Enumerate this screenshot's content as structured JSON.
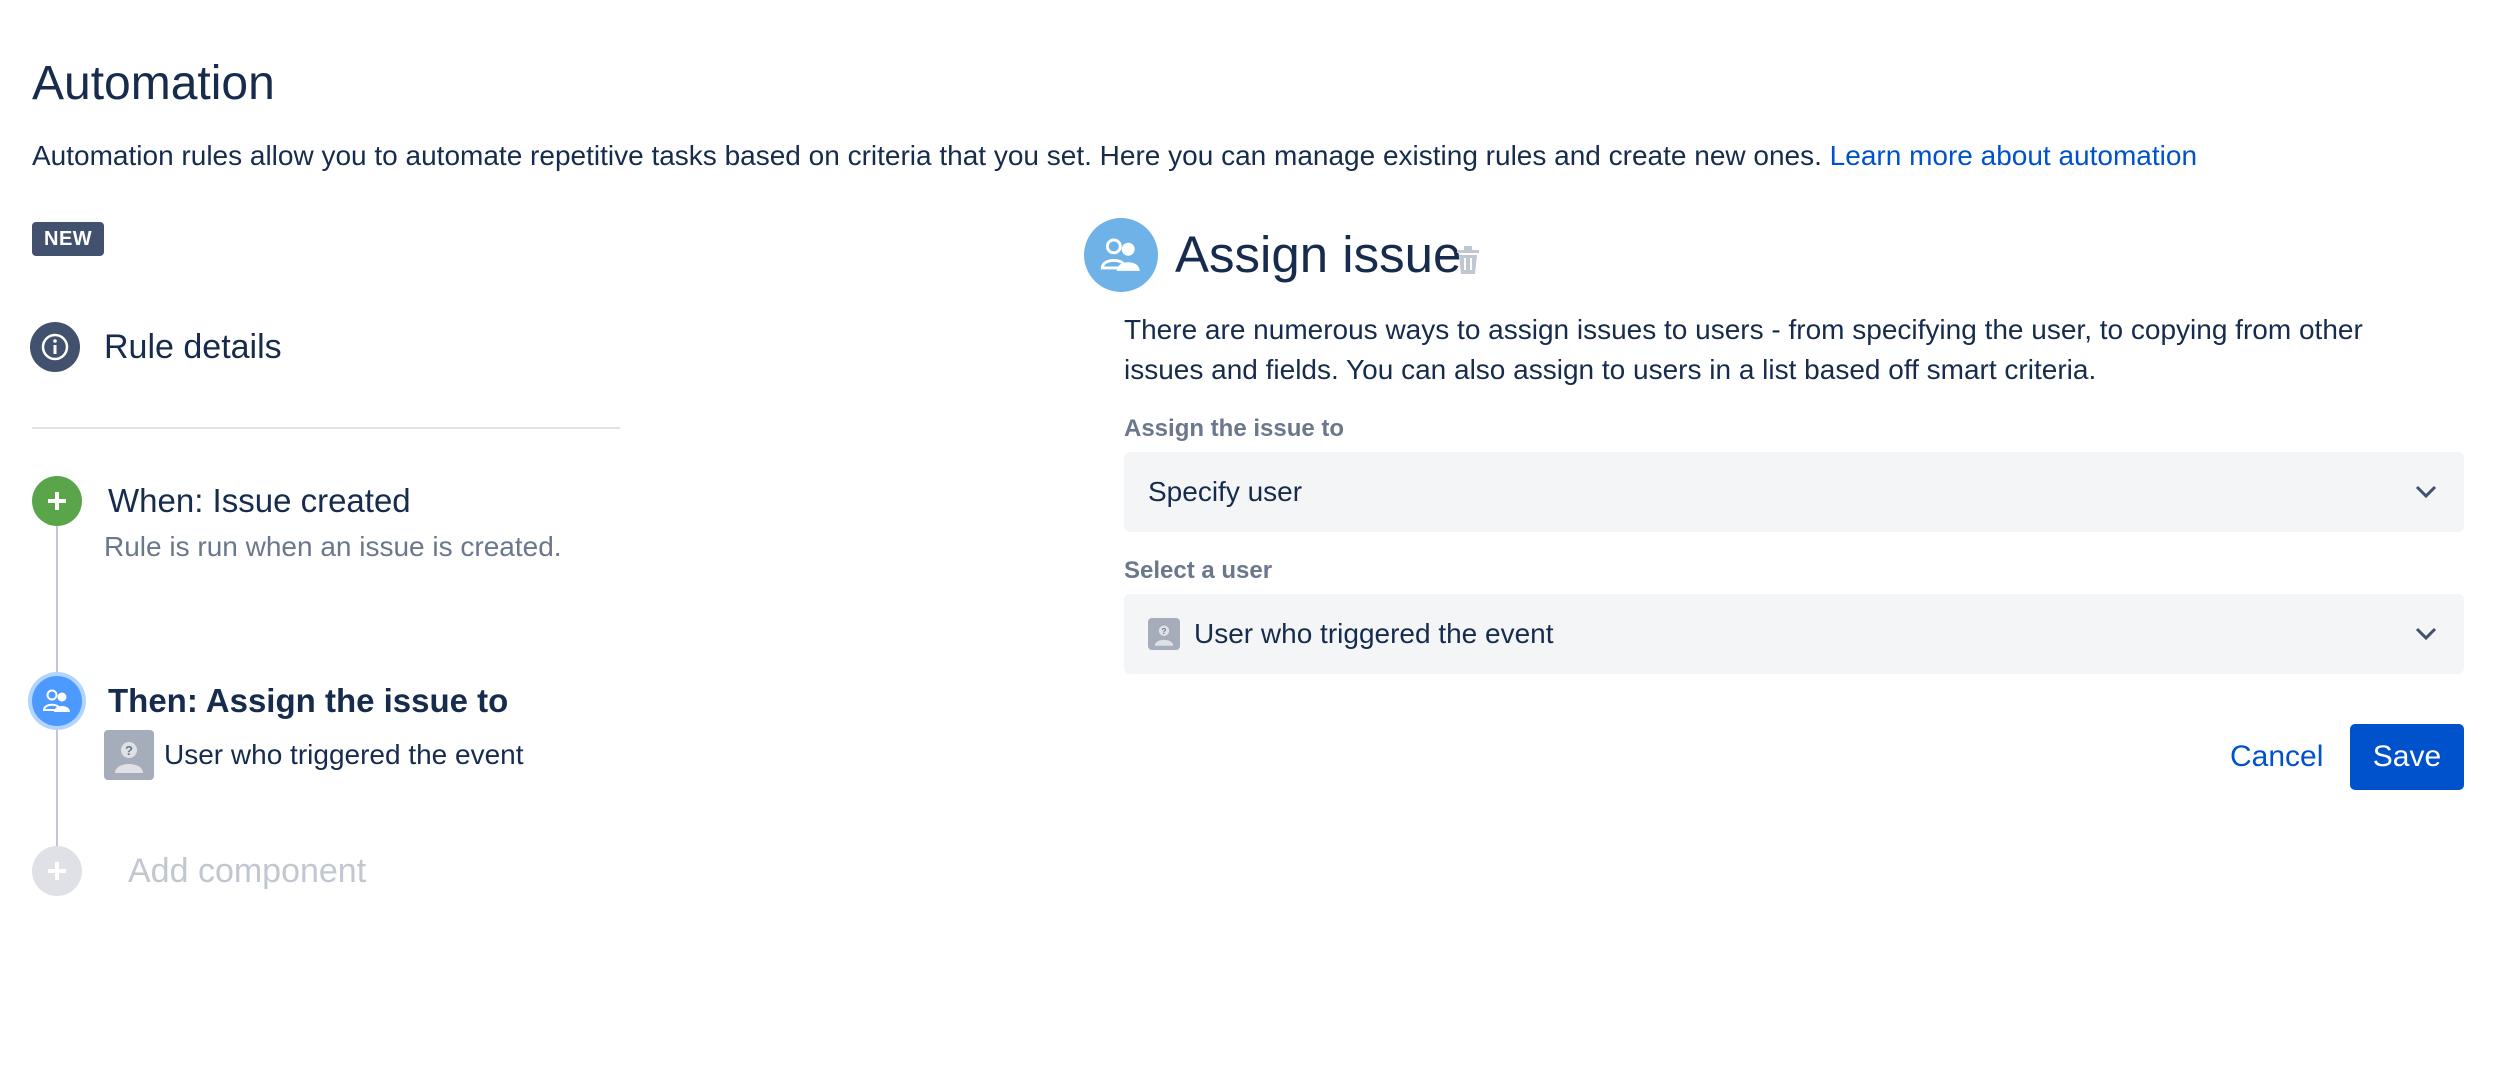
{
  "header": {
    "title": "Automation",
    "description": "Automation rules allow you to automate repetitive tasks based on criteria that you set. Here you can manage existing rules and create new ones.",
    "learn_more_link": "Learn more about automation"
  },
  "rule": {
    "badge": "NEW",
    "details_label": "Rule details",
    "trigger": {
      "title": "When: Issue created",
      "description": "Rule is run when an issue is created."
    },
    "action": {
      "title": "Then: Assign the issue to",
      "user": "User who triggered the event"
    },
    "add_component_label": "Add component"
  },
  "panel": {
    "title": "Assign issue",
    "description": "There are numerous ways to assign issues to users - from specifying the user, to copying from other issues and fields. You can also assign to users in a list based off smart criteria.",
    "assign_label": "Assign the issue to",
    "assign_value": "Specify user",
    "user_label": "Select a user",
    "user_value": "User who triggered the event",
    "cancel_label": "Cancel",
    "save_label": "Save"
  },
  "icons": {
    "rule_details": "info-icon",
    "trigger": "plus-icon",
    "action": "assign-user-icon",
    "add_component": "plus-icon",
    "delete": "trash-icon",
    "dropdown": "chevron-down-icon",
    "avatar": "unknown-user-avatar-icon"
  },
  "colors": {
    "primary": "#0052cc",
    "trigger_green": "#5aa549",
    "action_blue": "#4c9aff",
    "badge_gray": "#42526e",
    "text": "#172b4d",
    "subtle_text": "#6b778c"
  }
}
